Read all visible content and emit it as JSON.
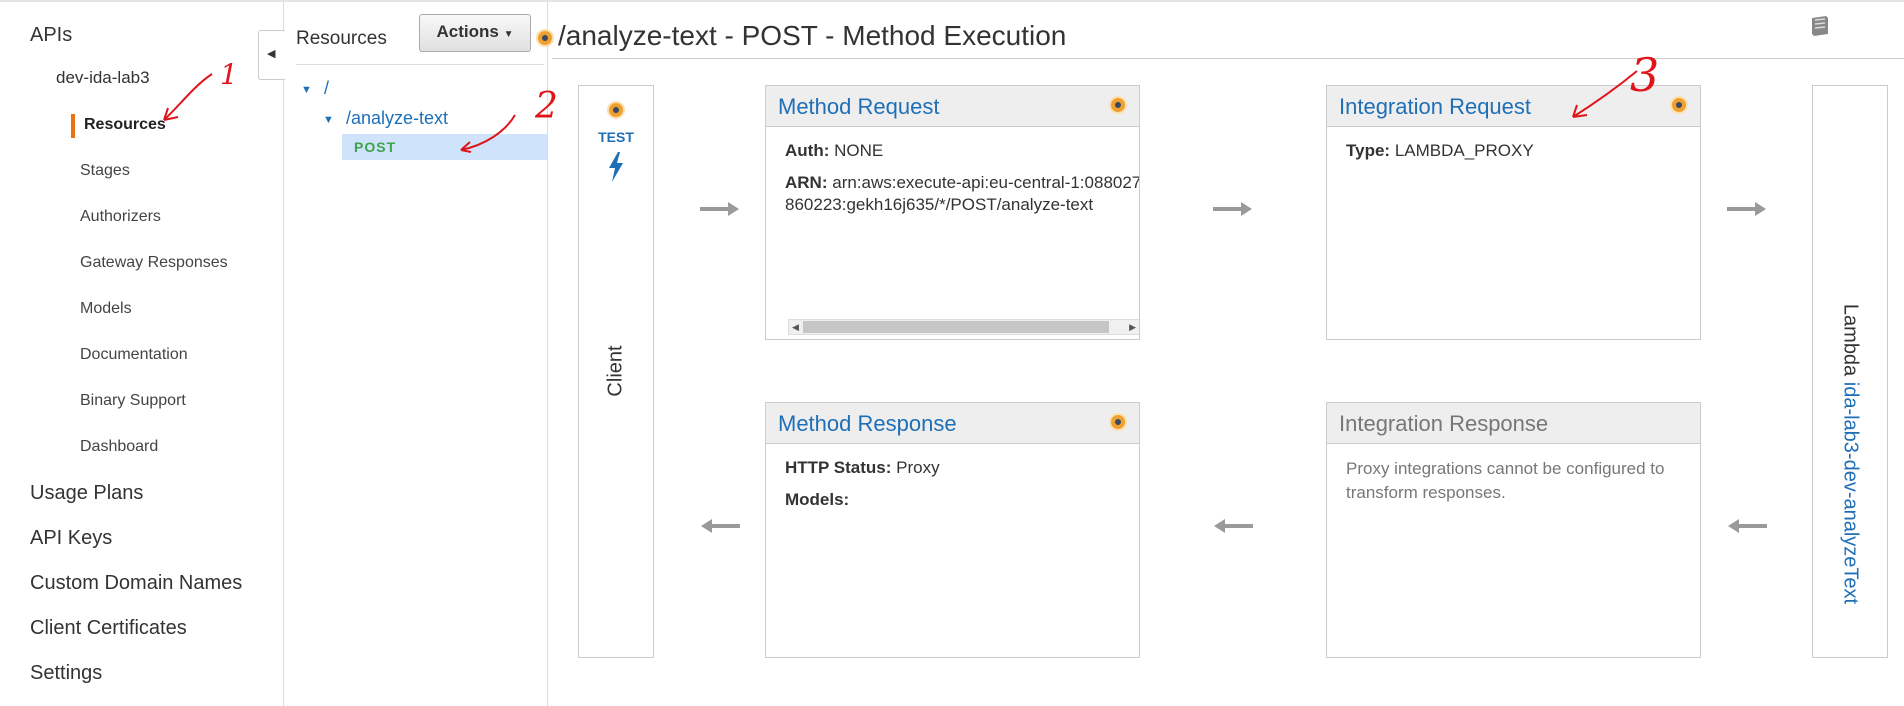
{
  "left_nav": {
    "apis_label": "APIs",
    "api_name": "dev-ida-lab3",
    "items": [
      {
        "label": "Resources"
      },
      {
        "label": "Stages"
      },
      {
        "label": "Authorizers"
      },
      {
        "label": "Gateway Responses"
      },
      {
        "label": "Models"
      },
      {
        "label": "Documentation"
      },
      {
        "label": "Binary Support"
      },
      {
        "label": "Dashboard"
      }
    ],
    "top_items": [
      {
        "label": "Usage Plans"
      },
      {
        "label": "API Keys"
      },
      {
        "label": "Custom Domain Names"
      },
      {
        "label": "Client Certificates"
      },
      {
        "label": "Settings"
      }
    ]
  },
  "resources_panel": {
    "title": "Resources",
    "actions_label": "Actions",
    "tree": {
      "root": "/",
      "child": "/analyze-text",
      "method": "POST"
    }
  },
  "main": {
    "title": "/analyze-text - POST - Method Execution",
    "client": {
      "test_label": "TEST",
      "label": "Client"
    },
    "method_request": {
      "title": "Method Request",
      "auth_key": "Auth:",
      "auth_value": "NONE",
      "arn_key": "ARN:",
      "arn_value": "arn:aws:execute-api:eu-central-1:088027860223:gekh16j635/*/POST/analyze-text"
    },
    "integration_request": {
      "title": "Integration Request",
      "type_key": "Type:",
      "type_value": "LAMBDA_PROXY"
    },
    "method_response": {
      "title": "Method Response",
      "status_key": "HTTP Status:",
      "status_value": "Proxy",
      "models_key": "Models:"
    },
    "integration_response": {
      "title": "Integration Response",
      "note": "Proxy integrations cannot be configured to transform responses."
    },
    "lambda": {
      "key": "Lambda",
      "value": "ida-lab3-dev-analyzeText"
    }
  },
  "annotations": {
    "one": "1",
    "two": "2",
    "three": "3"
  },
  "colors": {
    "link": "#1f6fb7",
    "accent": "#ec7211",
    "method_post": "#3fa34d",
    "annotation": "#e0141b"
  }
}
